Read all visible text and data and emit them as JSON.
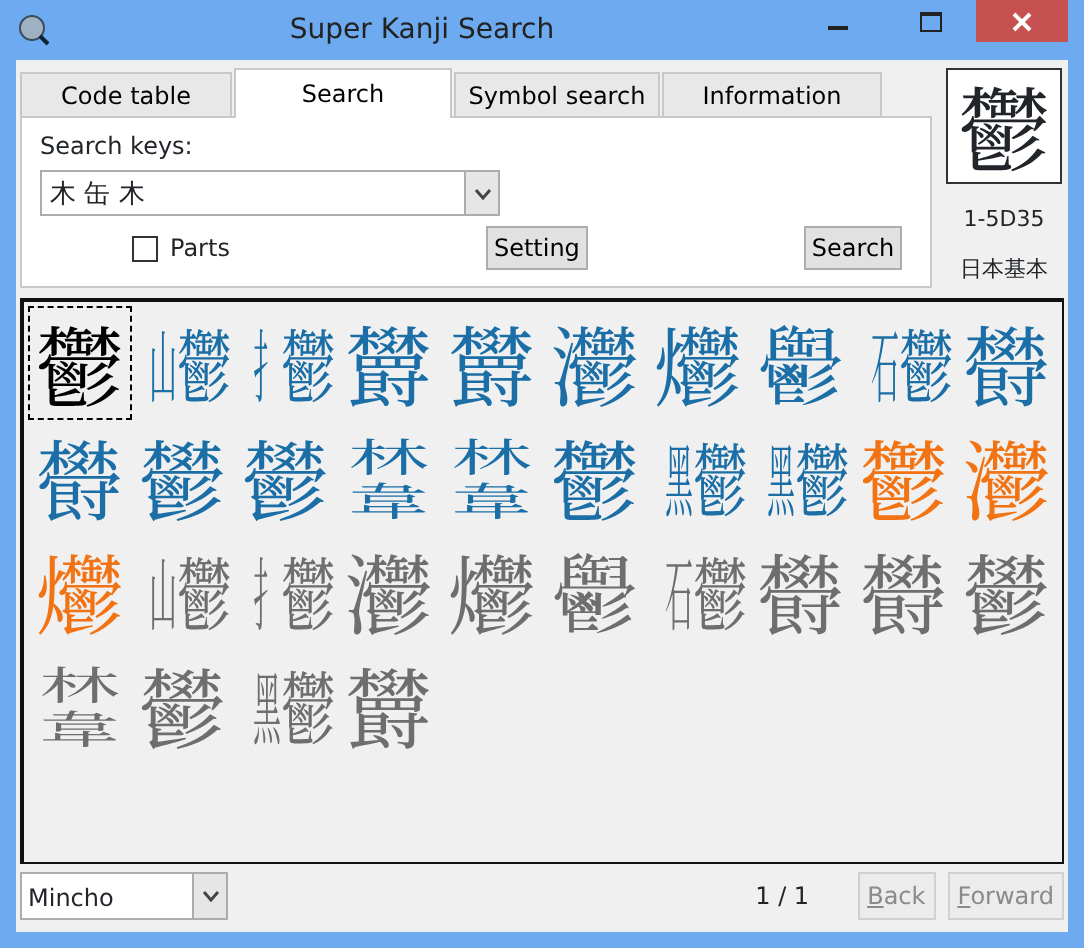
{
  "window": {
    "title": "Super Kanji Search"
  },
  "tabs": [
    {
      "label": "Code table",
      "selected": false
    },
    {
      "label": "Search",
      "selected": true
    },
    {
      "label": "Symbol search",
      "selected": false
    },
    {
      "label": "Information",
      "selected": false
    }
  ],
  "search": {
    "label": "Search keys:",
    "value": "木 缶 木",
    "parts_label": "Parts",
    "parts_checked": false,
    "setting_button": "Setting",
    "search_button": "Search"
  },
  "preview": {
    "kanji": "鬱",
    "code": "1-5D35",
    "set": "日本基本"
  },
  "results": [
    {
      "kind": "char",
      "kanji": "鬱",
      "color": "#000000",
      "selected": true
    },
    {
      "kind": "side",
      "parts": [
        "山",
        "鬱"
      ],
      "color": "#1b6ea6",
      "selected": false
    },
    {
      "kind": "side",
      "parts": [
        "扌",
        "鬱"
      ],
      "color": "#1b6ea6",
      "selected": false
    },
    {
      "kind": "char",
      "kanji": "欝",
      "color": "#1b6ea6",
      "selected": false
    },
    {
      "kind": "char",
      "kanji": "欝",
      "color": "#1b6ea6",
      "selected": false
    },
    {
      "kind": "char",
      "kanji": "灪",
      "color": "#1b6ea6",
      "selected": false
    },
    {
      "kind": "char",
      "kanji": "爩",
      "color": "#1b6ea6",
      "selected": false
    },
    {
      "kind": "char",
      "kanji": "𩰪",
      "color": "#1b6ea6",
      "selected": false
    },
    {
      "kind": "side",
      "parts": [
        "石",
        "鬱"
      ],
      "color": "#1b6ea6",
      "selected": false
    },
    {
      "kind": "char",
      "kanji": "欎",
      "color": "#1b6ea6",
      "selected": false
    },
    {
      "kind": "char",
      "kanji": "欎",
      "color": "#1b6ea6",
      "selected": false
    },
    {
      "kind": "char",
      "kanji": "鬰",
      "color": "#1b6ea6",
      "selected": false
    },
    {
      "kind": "char",
      "kanji": "鬰",
      "color": "#1b6ea6",
      "selected": false
    },
    {
      "kind": "stack",
      "parts": [
        "林",
        "韋"
      ],
      "color": "#1b6ea6",
      "selected": false
    },
    {
      "kind": "stack",
      "parts": [
        "林",
        "韋"
      ],
      "color": "#1b6ea6",
      "selected": false
    },
    {
      "kind": "char",
      "kanji": "鬱",
      "color": "#1b6ea6",
      "selected": false
    },
    {
      "kind": "side",
      "parts": [
        "黑",
        "鬱"
      ],
      "color": "#1b6ea6",
      "selected": false
    },
    {
      "kind": "side",
      "parts": [
        "黑",
        "鬱"
      ],
      "color": "#1b6ea6",
      "selected": false
    },
    {
      "kind": "char",
      "kanji": "鬱",
      "color": "#f27313",
      "selected": false
    },
    {
      "kind": "char",
      "kanji": "灪",
      "color": "#f27313",
      "selected": false
    },
    {
      "kind": "char",
      "kanji": "爩",
      "color": "#f27313",
      "selected": false
    },
    {
      "kind": "side",
      "parts": [
        "山",
        "鬱"
      ],
      "color": "#6e6e6e",
      "selected": false
    },
    {
      "kind": "side",
      "parts": [
        "扌",
        "鬱"
      ],
      "color": "#6e6e6e",
      "selected": false
    },
    {
      "kind": "char",
      "kanji": "灪",
      "color": "#6e6e6e",
      "selected": false
    },
    {
      "kind": "char",
      "kanji": "爩",
      "color": "#6e6e6e",
      "selected": false
    },
    {
      "kind": "char",
      "kanji": "𩰪",
      "color": "#6e6e6e",
      "selected": false
    },
    {
      "kind": "side",
      "parts": [
        "石",
        "鬱"
      ],
      "color": "#6e6e6e",
      "selected": false
    },
    {
      "kind": "char",
      "kanji": "欎",
      "color": "#6e6e6e",
      "selected": false
    },
    {
      "kind": "char",
      "kanji": "欎",
      "color": "#6e6e6e",
      "selected": false
    },
    {
      "kind": "char",
      "kanji": "鬰",
      "color": "#6e6e6e",
      "selected": false
    },
    {
      "kind": "stack",
      "parts": [
        "林",
        "韋"
      ],
      "color": "#6e6e6e",
      "selected": false
    },
    {
      "kind": "char",
      "kanji": "鬰",
      "color": "#6e6e6e",
      "selected": false
    },
    {
      "kind": "side",
      "parts": [
        "黑",
        "鬱"
      ],
      "color": "#6e6e6e",
      "selected": false
    },
    {
      "kind": "char",
      "kanji": "欝",
      "color": "#6e6e6e",
      "selected": false
    }
  ],
  "footer": {
    "font": "Mincho",
    "page": "1 / 1",
    "back_button": "Back",
    "back_disabled": true,
    "forward_button": "Forward",
    "forward_disabled": true
  }
}
